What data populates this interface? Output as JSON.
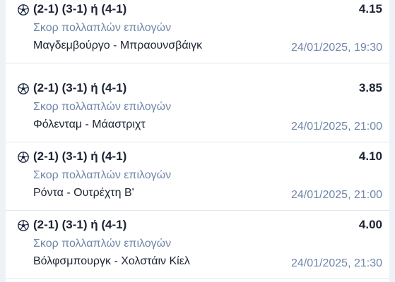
{
  "bets": [
    {
      "selection": "(2-1) (3-1) ή (4-1)",
      "odds": "4.15",
      "market": "Σκορ πολλαπλών επιλογών",
      "match": "Μαγδεμβούργο - Μπραουνσβάιγκ",
      "datetime": "24/01/2025, 19:30",
      "icon": "football-icon"
    },
    {
      "selection": "(2-1) (3-1) ή (4-1)",
      "odds": "3.85",
      "market": "Σκορ πολλαπλών επιλογών",
      "match": "Φόλενταμ - Μάαστριχτ",
      "datetime": "24/01/2025, 21:00",
      "icon": "football-icon"
    },
    {
      "selection": "(2-1) (3-1) ή (4-1)",
      "odds": "4.10",
      "market": "Σκορ πολλαπλών επιλογών",
      "match": "Ρόντα - Ουτρέχτη Β'",
      "datetime": "24/01/2025, 21:00",
      "icon": "football-icon"
    },
    {
      "selection": "(2-1) (3-1) ή (4-1)",
      "odds": "4.00",
      "market": "Σκορ πολλαπλών επιλογών",
      "match": "Βόλφσμπουργκ - Χολστάιν Κίελ",
      "datetime": "24/01/2025, 21:30",
      "icon": "football-icon"
    }
  ]
}
